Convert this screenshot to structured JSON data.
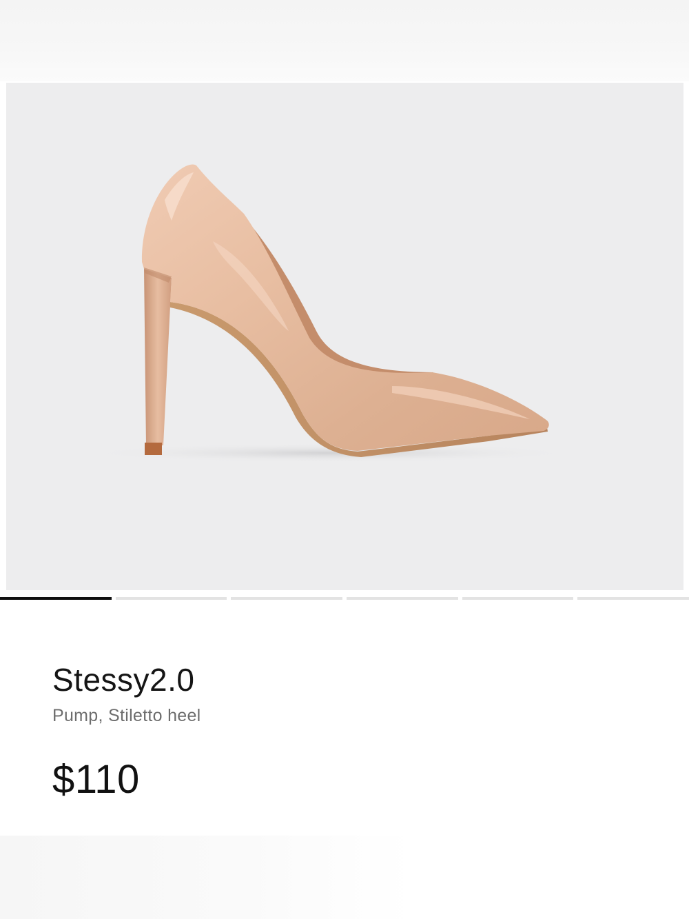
{
  "product": {
    "name": "Stessy2.0",
    "subtitle": "Pump, Stiletto heel",
    "price": "$110",
    "image_alt": "nude patent leather pointed-toe stiletto pump"
  },
  "gallery": {
    "image_count": 6,
    "active_index": 0
  },
  "colors": {
    "shoe_base": "#e3b79a",
    "background": "#ededee",
    "indicator_active": "#111111",
    "indicator_inactive": "#e3e3e3"
  }
}
